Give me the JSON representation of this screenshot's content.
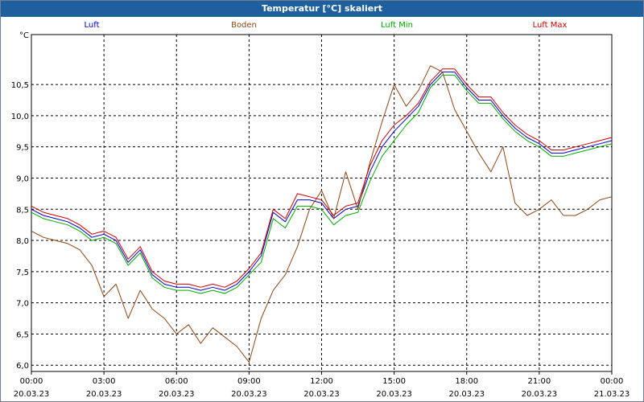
{
  "window": {
    "title": "Temperatur [°C] skaliert"
  },
  "chart_data": {
    "type": "line",
    "title": "Temperatur [°C] skaliert",
    "ylabel": "°C",
    "xlabel": "",
    "ylim": [
      5.9,
      11.3
    ],
    "xlim": [
      0,
      24
    ],
    "grid": true,
    "legend_placement": "top",
    "yticks": [
      6.0,
      6.5,
      7.0,
      7.5,
      8.0,
      8.5,
      9.0,
      9.5,
      10.0,
      10.5
    ],
    "ytick_labels": [
      "6,0",
      "6,5",
      "7,0",
      "7,5",
      "8,0",
      "8,5",
      "9,0",
      "9,5",
      "10,0",
      "10,5"
    ],
    "xticks": [
      0,
      3,
      6,
      9,
      12,
      15,
      18,
      21,
      24
    ],
    "xtick_labels": [
      [
        "00:00",
        "20.03.23"
      ],
      [
        "03:00",
        "20.03.23"
      ],
      [
        "06:00",
        "20.03.23"
      ],
      [
        "09:00",
        "20.03.23"
      ],
      [
        "12:00",
        "20.03.23"
      ],
      [
        "15:00",
        "20.03.23"
      ],
      [
        "18:00",
        "20.03.23"
      ],
      [
        "21:00",
        "20.03.23"
      ],
      [
        "00:00",
        "21.03.23"
      ]
    ],
    "series": [
      {
        "name": "Luft",
        "color": "#0000cc",
        "x": [
          0,
          0.5,
          1,
          1.5,
          2,
          2.5,
          3,
          3.5,
          4,
          4.5,
          5,
          5.5,
          6,
          6.5,
          7,
          7.5,
          8,
          8.5,
          9,
          9.5,
          10,
          10.5,
          11,
          11.5,
          12,
          12.5,
          13,
          13.5,
          14,
          14.5,
          15,
          15.5,
          16,
          16.5,
          17,
          17.5,
          18,
          18.5,
          19,
          19.5,
          20,
          20.5,
          21,
          21.5,
          22,
          22.5,
          23,
          23.5,
          24
        ],
        "y": [
          8.5,
          8.4,
          8.35,
          8.3,
          8.2,
          8.05,
          8.1,
          8.0,
          7.65,
          7.85,
          7.45,
          7.3,
          7.25,
          7.25,
          7.2,
          7.25,
          7.2,
          7.3,
          7.5,
          7.75,
          8.45,
          8.3,
          8.65,
          8.65,
          8.6,
          8.35,
          8.5,
          8.55,
          9.1,
          9.5,
          9.75,
          9.95,
          10.15,
          10.5,
          10.7,
          10.7,
          10.45,
          10.25,
          10.25,
          10.0,
          9.8,
          9.65,
          9.55,
          9.4,
          9.4,
          9.45,
          9.5,
          9.55,
          9.6
        ]
      },
      {
        "name": "Boden",
        "color": "#8b4513",
        "x": [
          0,
          0.5,
          1,
          1.5,
          2,
          2.5,
          3,
          3.5,
          4,
          4.5,
          5,
          5.5,
          6,
          6.5,
          7,
          7.5,
          8,
          8.5,
          9,
          9.5,
          10,
          10.5,
          11,
          11.5,
          12,
          12.5,
          13,
          13.5,
          14,
          14.5,
          15,
          15.5,
          16,
          16.5,
          17,
          17.5,
          18,
          18.5,
          19,
          19.5,
          20,
          20.5,
          21,
          21.5,
          22,
          22.5,
          23,
          23.5,
          24
        ],
        "y": [
          8.15,
          8.05,
          8.0,
          7.95,
          7.85,
          7.6,
          7.1,
          7.3,
          6.75,
          7.2,
          6.9,
          6.75,
          6.5,
          6.65,
          6.35,
          6.6,
          6.45,
          6.3,
          6.05,
          6.75,
          7.2,
          7.45,
          7.9,
          8.5,
          8.8,
          8.35,
          9.1,
          8.5,
          9.25,
          9.9,
          10.5,
          10.15,
          10.4,
          10.8,
          10.7,
          10.1,
          9.75,
          9.4,
          9.1,
          9.5,
          8.6,
          8.4,
          8.5,
          8.65,
          8.4,
          8.4,
          8.5,
          8.65,
          8.7
        ]
      },
      {
        "name": "Luft Min",
        "color": "#00aa00",
        "x": [
          0,
          0.5,
          1,
          1.5,
          2,
          2.5,
          3,
          3.5,
          4,
          4.5,
          5,
          5.5,
          6,
          6.5,
          7,
          7.5,
          8,
          8.5,
          9,
          9.5,
          10,
          10.5,
          11,
          11.5,
          12,
          12.5,
          13,
          13.5,
          14,
          14.5,
          15,
          15.5,
          16,
          16.5,
          17,
          17.5,
          18,
          18.5,
          19,
          19.5,
          20,
          20.5,
          21,
          21.5,
          22,
          22.5,
          23,
          23.5,
          24
        ],
        "y": [
          8.45,
          8.35,
          8.3,
          8.25,
          8.15,
          8.0,
          8.05,
          7.95,
          7.6,
          7.8,
          7.4,
          7.25,
          7.2,
          7.2,
          7.15,
          7.2,
          7.15,
          7.25,
          7.45,
          7.65,
          8.35,
          8.2,
          8.55,
          8.55,
          8.5,
          8.25,
          8.4,
          8.45,
          8.95,
          9.35,
          9.6,
          9.85,
          10.05,
          10.45,
          10.65,
          10.65,
          10.4,
          10.2,
          10.2,
          9.95,
          9.75,
          9.6,
          9.5,
          9.35,
          9.35,
          9.4,
          9.45,
          9.5,
          9.55
        ]
      },
      {
        "name": "Luft Max",
        "color": "#cc0000",
        "x": [
          0,
          0.5,
          1,
          1.5,
          2,
          2.5,
          3,
          3.5,
          4,
          4.5,
          5,
          5.5,
          6,
          6.5,
          7,
          7.5,
          8,
          8.5,
          9,
          9.5,
          10,
          10.5,
          11,
          11.5,
          12,
          12.5,
          13,
          13.5,
          14,
          14.5,
          15,
          15.5,
          16,
          16.5,
          17,
          17.5,
          18,
          18.5,
          19,
          19.5,
          20,
          20.5,
          21,
          21.5,
          22,
          22.5,
          23,
          23.5,
          24
        ],
        "y": [
          8.55,
          8.45,
          8.4,
          8.35,
          8.25,
          8.1,
          8.15,
          8.05,
          7.7,
          7.9,
          7.5,
          7.35,
          7.3,
          7.3,
          7.25,
          7.3,
          7.25,
          7.35,
          7.55,
          7.8,
          8.5,
          8.35,
          8.75,
          8.7,
          8.65,
          8.4,
          8.55,
          8.6,
          9.2,
          9.6,
          9.85,
          10.0,
          10.2,
          10.55,
          10.75,
          10.75,
          10.5,
          10.3,
          10.3,
          10.05,
          9.85,
          9.7,
          9.6,
          9.45,
          9.45,
          9.5,
          9.55,
          9.6,
          9.65
        ]
      }
    ]
  }
}
